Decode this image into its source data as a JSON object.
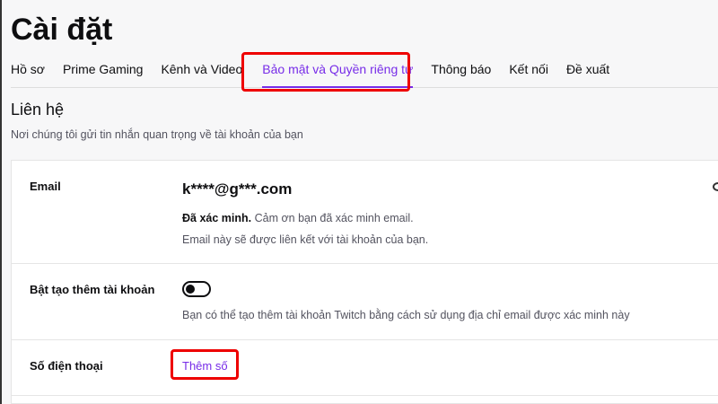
{
  "title": "Cài đặt",
  "tabs": [
    "Hồ sơ",
    "Prime Gaming",
    "Kênh và Video",
    "Bảo mật và Quyền riêng tư",
    "Thông báo",
    "Kết nối",
    "Đề xuất"
  ],
  "section": {
    "title": "Liên hệ",
    "subtitle": "Nơi chúng tôi gửi tin nhắn quan trọng về tài khoản của bạn"
  },
  "email": {
    "label": "Email",
    "value": "k****@g***.com",
    "verified_bold": "Đã xác minh.",
    "verified_text": " Cảm ơn bạn đã xác minh email.",
    "note": "Email này sẽ được liên kết với tài khoản của bạn."
  },
  "extra": {
    "label": "Bật tạo thêm tài khoản",
    "note": "Bạn có thể tạo thêm tài khoản Twitch bằng cách sử dụng địa chỉ email được xác minh này",
    "enabled": false
  },
  "phone": {
    "label": "Số điện thoại",
    "action": "Thêm số"
  }
}
